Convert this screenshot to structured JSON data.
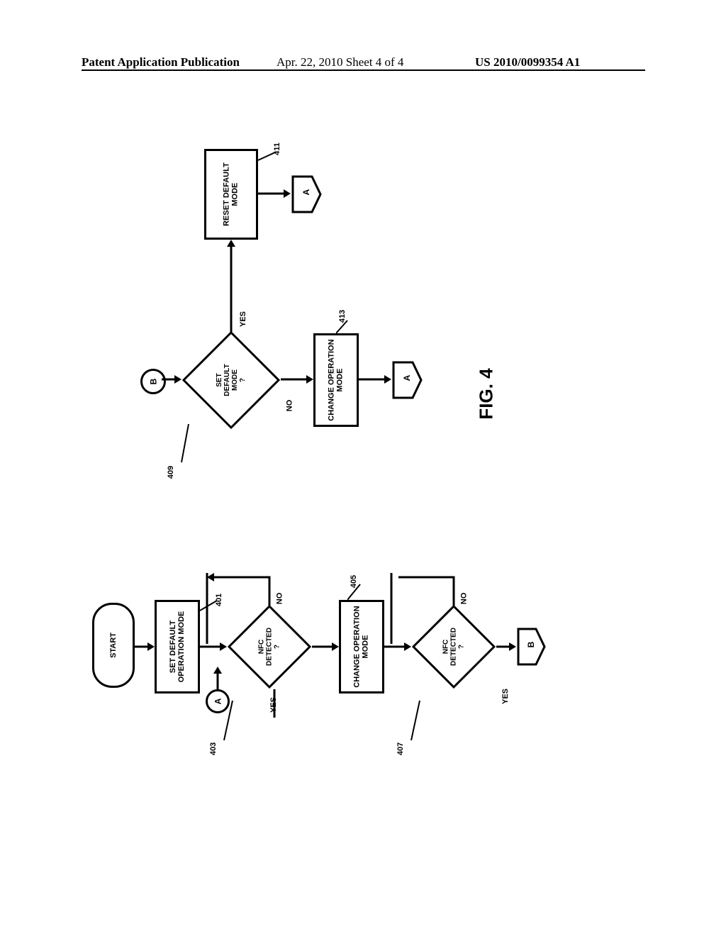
{
  "header": {
    "left": "Patent Application Publication",
    "mid": "Apr. 22, 2010  Sheet 4 of 4",
    "right": "US 2010/0099354 A1"
  },
  "fig_label": "FIG. 4",
  "nodes": {
    "start": "START",
    "p401": "SET DEFAULT\nOPERATION MODE",
    "d403": "NFC\nDETECTED\n?",
    "p405": "CHANGE OPERATION\nMODE",
    "d407": "NFC\nDETECTED\n?",
    "d409": "SET\nDEFAULT\nMODE\n?",
    "p411": "RESET DEFAULT\nMODE",
    "p413": "CHANGE OPERATION\nMODE"
  },
  "edges": {
    "yes": "YES",
    "no": "NO"
  },
  "refs": {
    "r401": "401",
    "r403": "403",
    "r405": "405",
    "r407": "407",
    "r409": "409",
    "r411": "411",
    "r413": "413"
  },
  "connectors": {
    "A": "A",
    "B": "B"
  }
}
